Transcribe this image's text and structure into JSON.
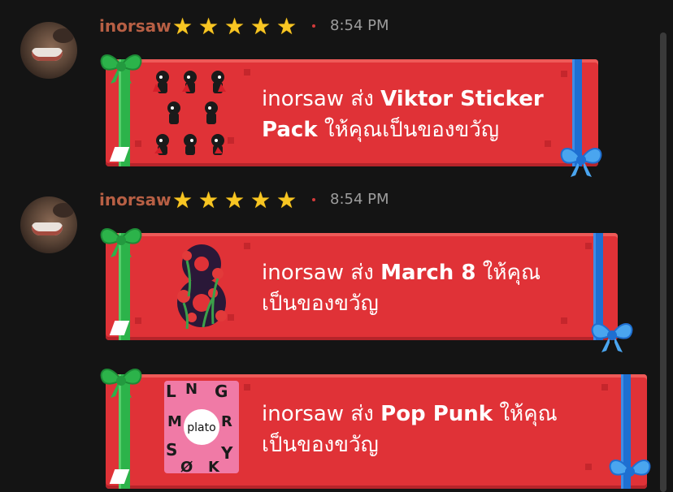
{
  "messages": [
    {
      "username": "inorsaw",
      "stars": [
        "⭐",
        "⭐",
        "⭐",
        "⭐",
        "⭐"
      ],
      "time": "8:54 PM",
      "gift": {
        "prefix": "inorsaw ส่ง ",
        "item": "Viktor Sticker Pack",
        "suffix": " ให้คุณเป็นของขวัญ"
      }
    },
    {
      "username": "inorsaw",
      "stars": [
        "⭐",
        "⭐",
        "⭐",
        "⭐",
        "⭐"
      ],
      "time": "8:54 PM",
      "gift": {
        "prefix": "inorsaw ส่ง ",
        "item": "March 8",
        "suffix": " ให้คุณเป็นของขวัญ"
      }
    },
    {
      "gift": {
        "prefix": "inorsaw ส่ง ",
        "item": "Pop Punk",
        "suffix": " ให้คุณเป็นของขวัญ"
      },
      "thumb_logo": "plato"
    }
  ],
  "colors": {
    "gift_bg": "#e03237",
    "username": "#b75f44",
    "ribbon_green": "#2cb34a",
    "ribbon_blue": "#1e6fd1"
  },
  "icons": [
    "avatar",
    "star-icon",
    "green-bow-icon",
    "blue-bow-icon",
    "viktor-sticker-thumbnail",
    "march8-thumbnail",
    "pop-punk-thumbnail"
  ]
}
